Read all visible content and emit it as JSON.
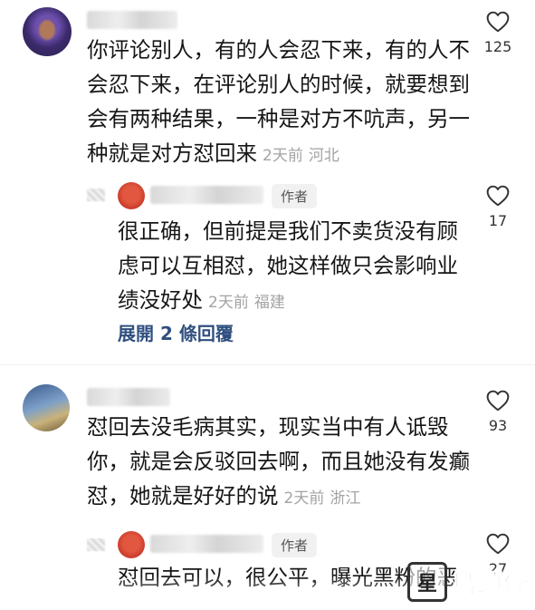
{
  "comments": [
    {
      "text": "你评论别人，有的人会忍下来，有的人不会忍下来，在评论别人的时候，就要想到会有两种结果，一种是对方不吭声，另一种就是对方怼回来",
      "lines": [
        "你评论别人，有的人会忍下来，有的人不",
        "会忍下来，在评论别人的时候，就要想到",
        "会有两种结果，一种是对方不吭声，另一",
        "种就是对方怼回来"
      ],
      "time": "2天前",
      "location": "河北",
      "likes": "125",
      "reply": {
        "author_badge": "作者",
        "lines": [
          "很正确，但前提是我们不卖货没有顾",
          "虑可以互相怼，她这样做只会影响业",
          "绩没好处"
        ],
        "time": "2天前",
        "location": "福建",
        "likes": "17"
      },
      "expand_label": "展開 2 條回覆"
    },
    {
      "lines": [
        "怼回去没毛病其实，现实当中有人诋毁",
        "你，就是会反驳回去啊，而且她没有发癫",
        "怼，她就是好好的说"
      ],
      "time": "2天前",
      "location": "浙江",
      "likes": "93",
      "reply": {
        "author_badge": "作者",
        "lines": [
          "怼回去可以，很公平，曝光黑粉的恶"
        ],
        "likes": "27"
      }
    }
  ],
  "watermark": {
    "logo_char": "星",
    "text": "島頭條"
  },
  "colors": {
    "text": "#161616",
    "meta": "#a3a3a3",
    "expand": "#2f4f7f",
    "badge_bg": "#f1f1f1"
  },
  "icons": {
    "like": "heart-outline-icon"
  }
}
